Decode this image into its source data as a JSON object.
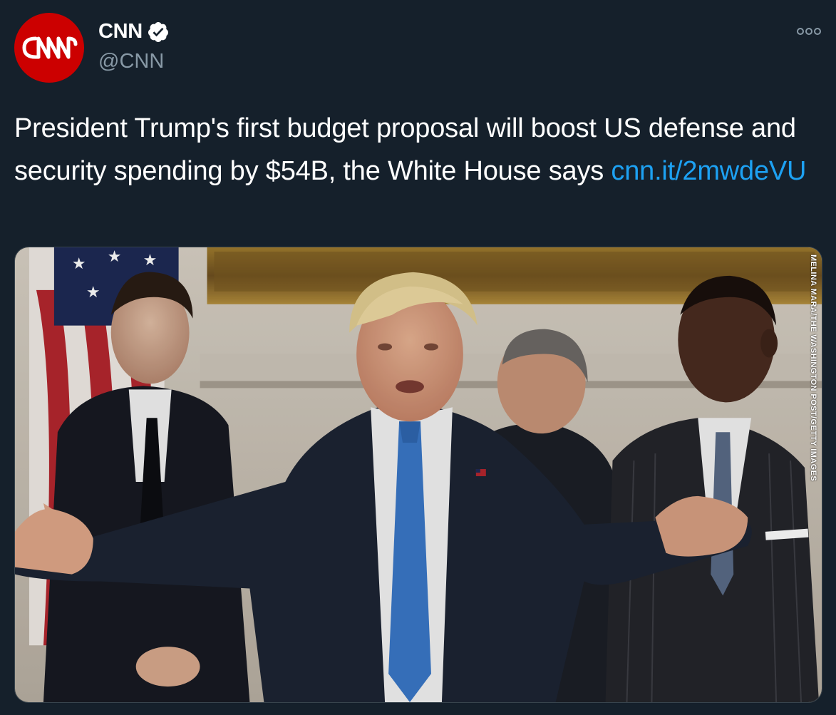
{
  "author": {
    "display_name": "CNN",
    "handle": "@CNN",
    "verified": true,
    "avatar_icon": "cnn-logo-icon"
  },
  "tweet": {
    "text": "President Trump's first budget proposal will boost US defense and security spending by $54B, the White House says ",
    "link_text": "cnn.it/2mwdeVU"
  },
  "media": {
    "photo_credit": "MELINA MARA/THE WASHINGTON POST/GETTY IMAGES"
  },
  "colors": {
    "background": "#15202b",
    "link": "#1da1f2",
    "secondary_text": "#8899a6",
    "avatar": "#cc0000"
  }
}
